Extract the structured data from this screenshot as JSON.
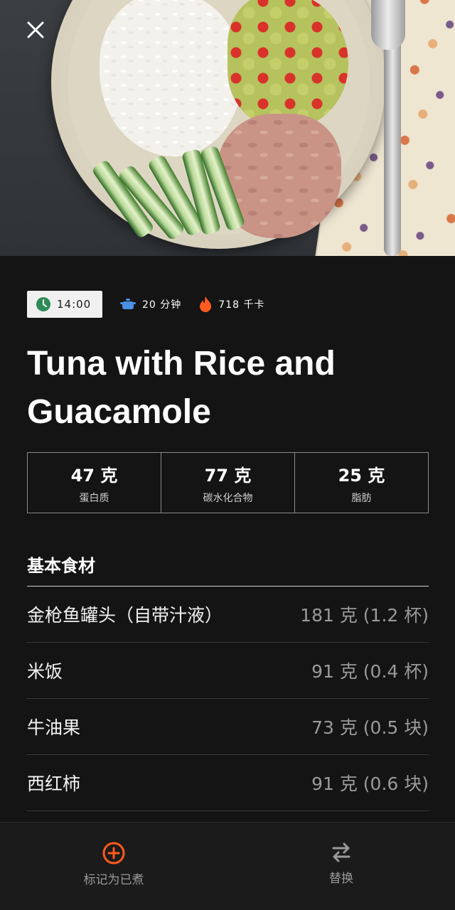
{
  "hero": {
    "close_icon": "close-icon"
  },
  "meta": {
    "time": "14:00",
    "duration": "20 分钟",
    "calories": "718 千卡",
    "icons": [
      "clock-icon",
      "pot-icon",
      "flame-icon"
    ],
    "colors": {
      "clock": "#2e8b57",
      "pot": "#4a90e2",
      "flame": "#ff5a1f"
    }
  },
  "recipe": {
    "title": "Tuna with Rice and Guacamole"
  },
  "macros": [
    {
      "value": "47 克",
      "label": "蛋白质"
    },
    {
      "value": "77 克",
      "label": "碳水化合物"
    },
    {
      "value": "25 克",
      "label": "脂肪"
    }
  ],
  "ingredients": {
    "heading": "基本食材",
    "items": [
      {
        "name": "金枪鱼罐头（自带汁液）",
        "amount": "181 克 (1.2 杯)"
      },
      {
        "name": "米饭",
        "amount": "91 克 (0.4 杯)"
      },
      {
        "name": "牛油果",
        "amount": "73 克 (0.5 块)"
      },
      {
        "name": "西红柿",
        "amount": "91 克 (0.6 块)"
      }
    ]
  },
  "bottom_bar": {
    "mark_cooked": "标记为已煮",
    "replace": "替换",
    "accent": "#ff5a1f"
  }
}
